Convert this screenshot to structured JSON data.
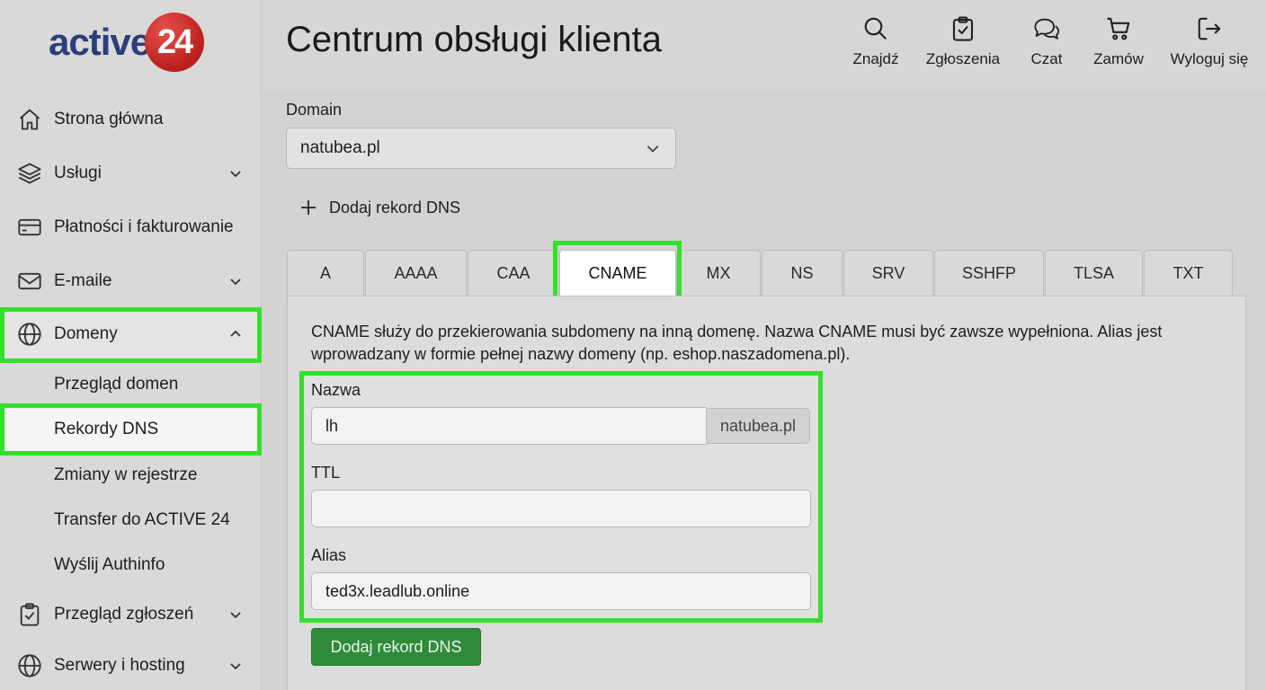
{
  "brand": {
    "logo_text": "active",
    "logo_number": "24",
    "accent": "#c42a26",
    "text_color": "#2c3e7a"
  },
  "header": {
    "title": "Centrum obsługi klienta",
    "actions": [
      {
        "label": "Znajdź",
        "icon": "search-icon"
      },
      {
        "label": "Zgłoszenia",
        "icon": "clipboard-check-icon"
      },
      {
        "label": "Czat",
        "icon": "chat-icon"
      },
      {
        "label": "Zamów",
        "icon": "cart-icon"
      },
      {
        "label": "Wyloguj się",
        "icon": "logout-icon"
      }
    ]
  },
  "sidebar": {
    "items": [
      {
        "label": "Strona główna",
        "icon": "home-icon"
      },
      {
        "label": "Usługi",
        "icon": "layers-icon"
      },
      {
        "label": "Płatności i fakturowanie",
        "icon": "credit-card-icon"
      },
      {
        "label": "E-maile",
        "icon": "mail-icon"
      },
      {
        "label": "Domeny",
        "icon": "globe-icon"
      },
      {
        "label": "Przegląd zgłoszeń",
        "icon": "clipboard-check-icon"
      },
      {
        "label": "Serwery i hosting",
        "icon": "globe-icon"
      }
    ],
    "subitems": [
      {
        "label": "Przegląd domen"
      },
      {
        "label": "Rekordy DNS"
      },
      {
        "label": "Zmiany w rejestrze"
      },
      {
        "label": "Transfer do ACTIVE 24"
      },
      {
        "label": "Wyślij Authinfo"
      }
    ]
  },
  "main": {
    "domain_label": "Domain",
    "domain_value": "natubea.pl",
    "add_record_link": "Dodaj rekord DNS",
    "tabs": [
      "A",
      "AAAA",
      "CAA",
      "CNAME",
      "MX",
      "NS",
      "SRV",
      "SSHFP",
      "TLSA",
      "TXT"
    ],
    "active_tab": "CNAME",
    "description": "CNAME służy do przekierowania subdomeny na inną domenę. Nazwa CNAME musi być zawsze wypełniona. Alias jest wprowadzany w formie pełnej nazwy domeny (np. eshop.naszadomena.pl).",
    "form": {
      "name_label": "Nazwa",
      "name_value": "lh",
      "name_suffix": "natubea.pl",
      "ttl_label": "TTL",
      "ttl_value": "",
      "alias_label": "Alias",
      "alias_value": "ted3x.leadlub.online"
    },
    "submit_label": "Dodaj rekord DNS",
    "highlight_color": "#33e02b",
    "button_color": "#2e8b3a"
  }
}
